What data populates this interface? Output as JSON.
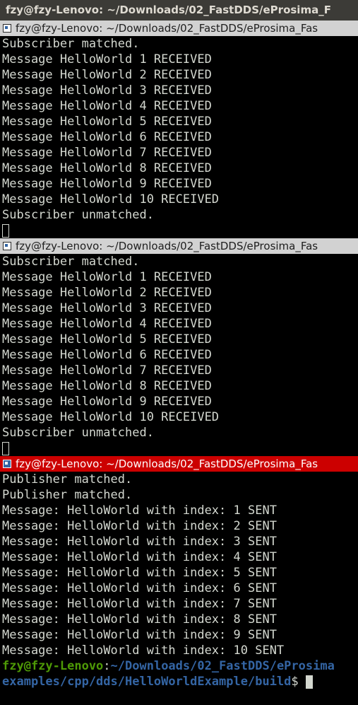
{
  "window": {
    "title": "fzy@fzy-Lenovo: ~/Downloads/02_FastDDS/eProsima_F"
  },
  "panes": [
    {
      "title": "fzy@fzy-Lenovo: ~/Downloads/02_FastDDS/eProsima_Fas",
      "active": false,
      "lines": [
        "Subscriber matched.",
        "Message HelloWorld 1 RECEIVED",
        "Message HelloWorld 2 RECEIVED",
        "Message HelloWorld 3 RECEIVED",
        "Message HelloWorld 4 RECEIVED",
        "Message HelloWorld 5 RECEIVED",
        "Message HelloWorld 6 RECEIVED",
        "Message HelloWorld 7 RECEIVED",
        "Message HelloWorld 8 RECEIVED",
        "Message HelloWorld 9 RECEIVED",
        "Message HelloWorld 10 RECEIVED",
        "Subscriber unmatched."
      ]
    },
    {
      "title": "fzy@fzy-Lenovo: ~/Downloads/02_FastDDS/eProsima_Fas",
      "active": false,
      "lines": [
        "Subscriber matched.",
        "Message HelloWorld 1 RECEIVED",
        "Message HelloWorld 2 RECEIVED",
        "Message HelloWorld 3 RECEIVED",
        "Message HelloWorld 4 RECEIVED",
        "Message HelloWorld 5 RECEIVED",
        "Message HelloWorld 6 RECEIVED",
        "Message HelloWorld 7 RECEIVED",
        "Message HelloWorld 8 RECEIVED",
        "Message HelloWorld 9 RECEIVED",
        "Message HelloWorld 10 RECEIVED",
        "Subscriber unmatched."
      ]
    },
    {
      "title": "fzy@fzy-Lenovo: ~/Downloads/02_FastDDS/eProsima_Fas",
      "active": true,
      "lines": [
        "Publisher matched.",
        "Publisher matched.",
        "Message: HelloWorld with index: 1 SENT",
        "Message: HelloWorld with index: 2 SENT",
        "Message: HelloWorld with index: 3 SENT",
        "Message: HelloWorld with index: 4 SENT",
        "Message: HelloWorld with index: 5 SENT",
        "Message: HelloWorld with index: 6 SENT",
        "Message: HelloWorld with index: 7 SENT",
        "Message: HelloWorld with index: 8 SENT",
        "Message: HelloWorld with index: 9 SENT",
        "Message: HelloWorld with index: 10 SENT"
      ],
      "prompt": {
        "user_host": "fzy@fzy-Lenovo",
        "colon": ":",
        "path_line1": "~/Downloads/02_FastDDS/eProsima",
        "path_line2": "examples/cpp/dds/HelloWorldExample/build",
        "symbol": "$ "
      }
    }
  ],
  "colors": {
    "terminal_bg": "#000000",
    "terminal_fg": "#d3d7cf",
    "prompt_user": "#4e9a06",
    "prompt_path": "#3465a4",
    "active_pane_header": "#cc0000",
    "inactive_pane_header": "#d2d2d2"
  }
}
